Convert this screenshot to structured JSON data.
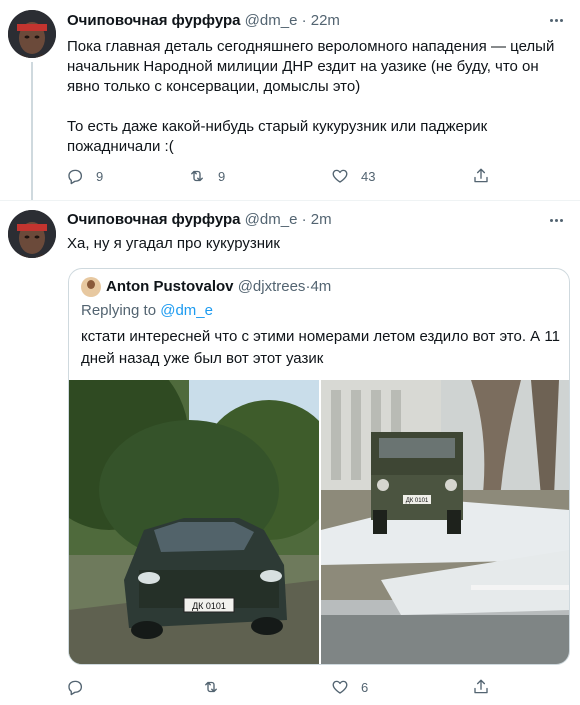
{
  "tweet1": {
    "author_name": "Очиповочная фурфура",
    "author_handle": "@dm_e",
    "separator": " · ",
    "time": "22m",
    "text_lines": [
      "Пока главная деталь сегодняшнего вероломного нападения — целый",
      "начальник Народной милиции ДНР ездит на уазике (не буду, что он",
      "явно только с консервации, домыслы это)"
    ],
    "text_lines_b": [
      "То есть даже какой-нибудь старый кукурузник или паджерик",
      "пожадничали :("
    ],
    "replies": "9",
    "retweets": "9",
    "likes": "43"
  },
  "tweet2": {
    "author_name": "Очиповочная фурфура",
    "author_handle": "@dm_e",
    "separator": " · ",
    "time": "2m",
    "text": "Ха, ну я угадал про кукурузник",
    "replies": "",
    "retweets": "",
    "likes": "6"
  },
  "quote": {
    "author_name": "Anton Pustovalov",
    "author_handle": "@djxtrees",
    "separator": " · ",
    "time": "4m",
    "replying_prefix": "Replying to ",
    "replying_to": "@dm_e",
    "text_lines": [
      "кстати интересней что с этими номерами летом ездило вот это. А 11",
      "дней назад уже был вот этот уазик"
    ],
    "plate_left": "ДК 0101",
    "plate_right": "ДК 0101"
  },
  "icons": {
    "reply": "reply-icon",
    "retweet": "retweet-icon",
    "like": "heart-icon",
    "share": "share-icon",
    "more": "more-icon"
  },
  "colors": {
    "text": "#0f1419",
    "secondary": "#536471",
    "link": "#1d9bf0",
    "border": "#cfd9de"
  }
}
